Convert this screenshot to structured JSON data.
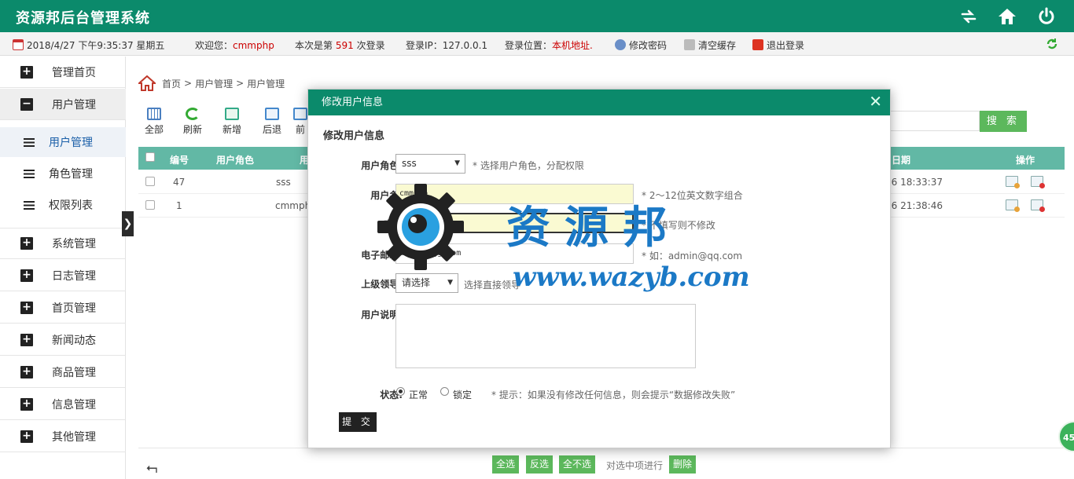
{
  "header": {
    "title": "资源邦后台管理系统",
    "icons": [
      "swap-icon",
      "home-icon",
      "power-icon"
    ]
  },
  "infobar": {
    "datetime": "2018/4/27 下午9:35:37 星期五",
    "welcome_label": "欢迎您：",
    "username": "cmmphp",
    "login_prefix": "本次是第",
    "login_count": "591",
    "login_suffix": "次登录",
    "ip_label": "登录IP：",
    "ip": "127.0.0.1",
    "location_label": "登录位置：",
    "location": "本机地址.",
    "change_password": "修改密码",
    "clear_cache": "清空缓存",
    "logout": "退出登录"
  },
  "sidebar": {
    "items": [
      {
        "label": "管理首页",
        "expanded": false
      },
      {
        "label": "用户管理",
        "expanded": true
      },
      {
        "label": "系统管理",
        "expanded": false
      },
      {
        "label": "日志管理",
        "expanded": false
      },
      {
        "label": "首页管理",
        "expanded": false
      },
      {
        "label": "新闻动态",
        "expanded": false
      },
      {
        "label": "商品管理",
        "expanded": false
      },
      {
        "label": "信息管理",
        "expanded": false
      },
      {
        "label": "其他管理",
        "expanded": false
      }
    ],
    "subitems": [
      {
        "label": "用户管理",
        "active": true
      },
      {
        "label": "角色管理",
        "active": false
      },
      {
        "label": "权限列表",
        "active": false
      }
    ],
    "toggle": "❯"
  },
  "breadcrumb": {
    "items": [
      "首页",
      "用户管理",
      "用户管理"
    ],
    "separator": ">"
  },
  "toolbar": {
    "buttons": [
      "全部",
      "刷新",
      "新增",
      "后退",
      "前"
    ],
    "search_label": "搜 索"
  },
  "table": {
    "headers": [
      "编号",
      "用户角色",
      "用",
      "日期",
      "操作"
    ],
    "rows": [
      {
        "id": "47",
        "name": "sss",
        "date": "26 18:33:37"
      },
      {
        "id": "1",
        "name": "cmmph",
        "date": "16 21:38:46"
      }
    ]
  },
  "bottom": {
    "select_all": "全选",
    "invert": "反选",
    "select_none": "全不选",
    "action_text": "对选中项进行",
    "delete": "删除"
  },
  "float_badge": "45",
  "modal": {
    "title": "修改用户信息",
    "subtitle": "修改用户信息",
    "close": "✕",
    "fields": {
      "role": {
        "label": "用户角色:",
        "value": "sss",
        "hint": "* 选择用户角色，分配权限"
      },
      "username": {
        "label": "用户名:",
        "value": "cmmphp",
        "hint": "* 2～12位英文数字组合"
      },
      "password": {
        "label": "密码",
        "value": "••",
        "hint": "* 不填写则不修改"
      },
      "email": {
        "label": "电子邮箱:",
        "value": "asdadsdgg.com",
        "hint": "* 如：admin@qq.com"
      },
      "leader": {
        "label": "上级领导:",
        "value": "请选择",
        "hint": "选择直接领导"
      },
      "desc": {
        "label": "用户说明:"
      },
      "status": {
        "label": "状态:",
        "options": [
          "正常",
          "锁定"
        ],
        "selected": "正常",
        "hint": "* 提示：如果没有修改任何信息，则会提示“数据修改失败”"
      }
    },
    "submit": "提 交"
  },
  "watermark": {
    "text": "资源邦",
    "url": "www.wazyb.com"
  }
}
